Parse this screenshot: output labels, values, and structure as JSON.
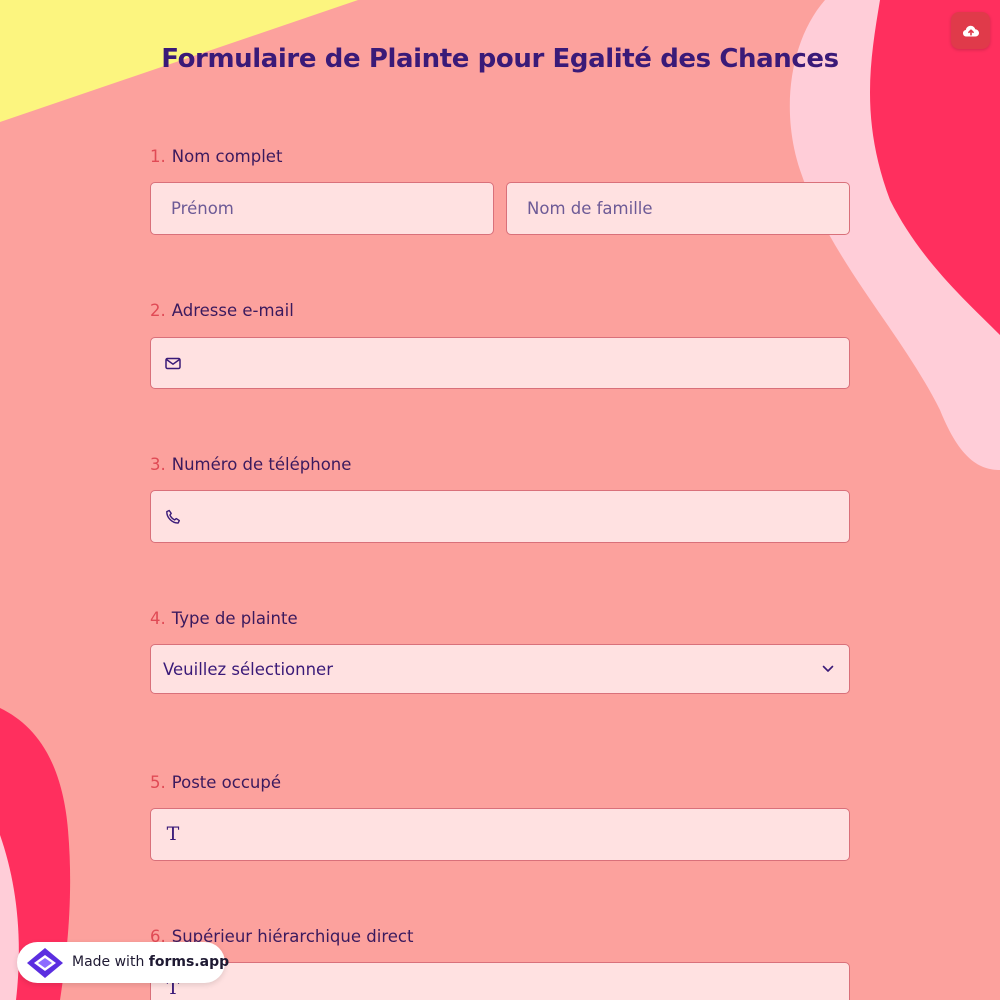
{
  "form": {
    "title": "Formulaire de Plainte pour Egalité des Chances"
  },
  "toolbar": {
    "upload_icon": "cloud-upload-icon"
  },
  "questions": [
    {
      "number": "1.",
      "label": "Nom complet"
    },
    {
      "number": "2.",
      "label": "Adresse e-mail"
    },
    {
      "number": "3.",
      "label": "Numéro de téléphone"
    },
    {
      "number": "4.",
      "label": "Type de plainte"
    },
    {
      "number": "5.",
      "label": "Poste occupé"
    },
    {
      "number": "6.",
      "label": "Supérieur hiérarchique direct"
    }
  ],
  "fields": {
    "first_name_placeholder": "Prénom",
    "last_name_placeholder": "Nom de famille",
    "email_value": "",
    "phone_value": "",
    "complaint_type_value": "Veuillez sélectionner",
    "position_value": "",
    "supervisor_value": ""
  },
  "icons": {
    "email": "mail-icon",
    "phone": "phone-icon",
    "text": "text-icon",
    "dropdown": "chevron-down-icon"
  },
  "badge": {
    "prefix": "Made with",
    "brand": "forms.app"
  },
  "colors": {
    "background": "#fca19d",
    "title": "#3a1a78",
    "question_number": "#e04a55",
    "field_fill": "#ffe1e1",
    "field_border": "#d9707a",
    "accent_red": "#e03a4a",
    "blob_pink": "#ff2f5e",
    "blob_light": "#ffcdd8",
    "corner_yellow": "#fcf57f"
  }
}
